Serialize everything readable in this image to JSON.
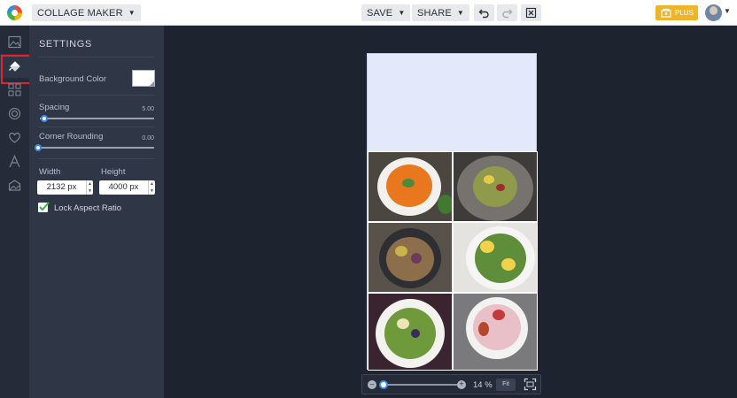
{
  "header": {
    "app_menu_label": "COLLAGE MAKER",
    "save_label": "SAVE",
    "share_label": "SHARE",
    "plus_label": "PLUS"
  },
  "rail": {
    "items": [
      "photos-icon",
      "paint-bucket-icon",
      "layout-grid-icon",
      "overlay-icon",
      "heart-icon",
      "text-icon",
      "frame-icon"
    ],
    "active": "paint-bucket-icon"
  },
  "settings": {
    "title": "SETTINGS",
    "background_color_label": "Background Color",
    "background_color": "#ffffff",
    "spacing_label": "Spacing",
    "spacing_value": "5.00",
    "corner_label": "Corner Rounding",
    "corner_value": "0.00",
    "width_label": "Width",
    "height_label": "Height",
    "width_value": "2132 px",
    "height_value": "4000 px",
    "lock_label": "Lock Aspect Ratio",
    "lock_checked": true
  },
  "canvas": {
    "collage_background": "#e3e9fb",
    "photos": [
      "pumpkin soup",
      "salad bowl",
      "nut plate",
      "egg salad",
      "fruit salad",
      "smoothie bowl"
    ]
  },
  "zoom": {
    "percent": "14 %",
    "fit_label": "Fit",
    "level": 0.14
  },
  "colors": {
    "accent": "#3a8ee6",
    "plus": "#f0b429",
    "highlight": "#e8222c",
    "panel": "#2f3646"
  }
}
